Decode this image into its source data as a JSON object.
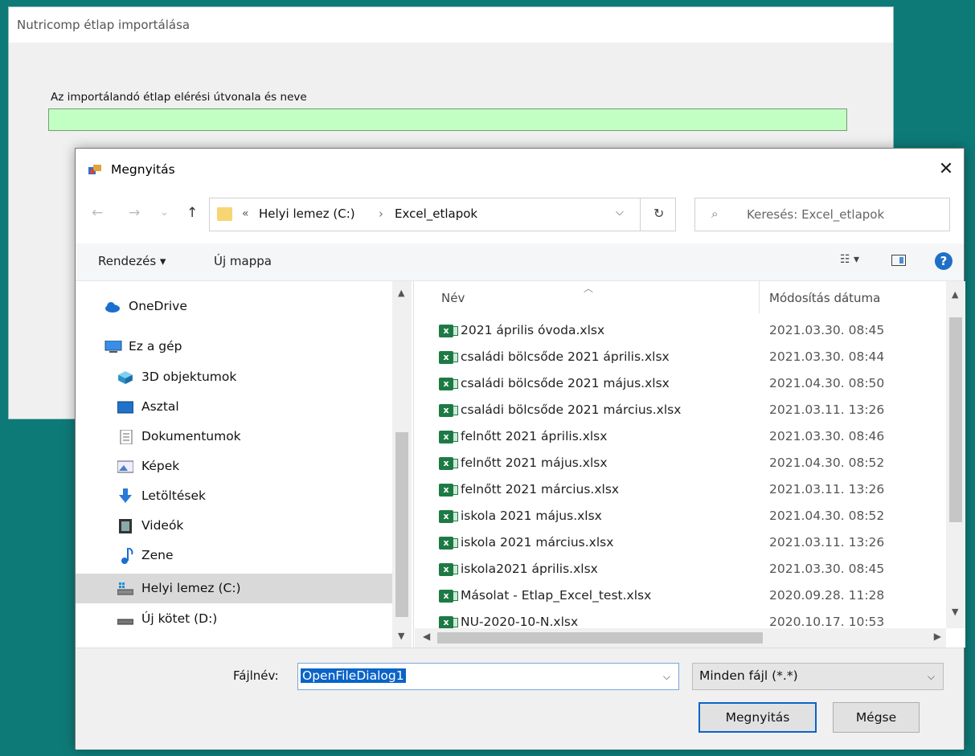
{
  "background_window": {
    "title": "Nutricomp étlap importálása",
    "path_label": "Az importálandó étlap elérési útvonala és neve",
    "path_value": ""
  },
  "dialog": {
    "title": "Megnyitás",
    "close": "✕",
    "nav": {
      "back": "←",
      "forward": "→",
      "recent": "⌄",
      "up": "↑"
    },
    "address": {
      "overflow": "«",
      "crumb1": "Helyi lemez (C:)",
      "separator": "›",
      "crumb2": "Excel_etlapok",
      "dropdown": "⌵",
      "refresh": "↻"
    },
    "search": {
      "icon": "⌕",
      "placeholder": "Keresés: Excel_etlapok"
    },
    "toolbar": {
      "organize": "Rendezés ▾",
      "new_folder": "Új mappa",
      "view": "☷ ▾",
      "help": "?"
    },
    "tree": [
      {
        "label": "OneDrive",
        "icon": "cloud-icon"
      },
      {
        "label": "Ez a gép",
        "icon": "computer-icon"
      },
      {
        "label": "3D objektumok",
        "icon": "cube-icon"
      },
      {
        "label": "Asztal",
        "icon": "desktop-icon"
      },
      {
        "label": "Dokumentumok",
        "icon": "document-icon"
      },
      {
        "label": "Képek",
        "icon": "pictures-icon"
      },
      {
        "label": "Letöltések",
        "icon": "download-icon"
      },
      {
        "label": "Videók",
        "icon": "video-icon"
      },
      {
        "label": "Zene",
        "icon": "music-icon"
      },
      {
        "label": "Helyi lemez (C:)",
        "icon": "drive-icon",
        "selected": true
      },
      {
        "label": "Új kötet (D:)",
        "icon": "drive-icon"
      }
    ],
    "columns": {
      "name": "Név",
      "modified": "Módosítás dátuma"
    },
    "files": [
      {
        "name": "2021 április óvoda.xlsx",
        "modified": "2021.03.30. 08:45"
      },
      {
        "name": "családi bölcsőde 2021 április.xlsx",
        "modified": "2021.03.30. 08:44"
      },
      {
        "name": "családi bölcsőde 2021 május.xlsx",
        "modified": "2021.04.30. 08:50"
      },
      {
        "name": "családi bölcsőde 2021 március.xlsx",
        "modified": "2021.03.11. 13:26"
      },
      {
        "name": "felnőtt 2021 április.xlsx",
        "modified": "2021.03.30. 08:46"
      },
      {
        "name": "felnőtt 2021 május.xlsx",
        "modified": "2021.04.30. 08:52"
      },
      {
        "name": "felnőtt 2021 március.xlsx",
        "modified": "2021.03.11. 13:26"
      },
      {
        "name": "iskola 2021 május.xlsx",
        "modified": "2021.04.30. 08:52"
      },
      {
        "name": "iskola 2021 március.xlsx",
        "modified": "2021.03.11. 13:26"
      },
      {
        "name": "iskola2021 április.xlsx",
        "modified": "2021.03.30. 08:45"
      },
      {
        "name": "Másolat - Etlap_Excel_test.xlsx",
        "modified": "2020.09.28. 11:28"
      },
      {
        "name": "NU-2020-10-N.xlsx",
        "modified": "2020.10.17. 10:53"
      }
    ],
    "filename_label": "Fájlnév:",
    "filename_value": "OpenFileDialog1",
    "filetype_value": "Minden fájl (*.*)",
    "open_button": "Megnyitás",
    "cancel_button": "Mégse"
  }
}
